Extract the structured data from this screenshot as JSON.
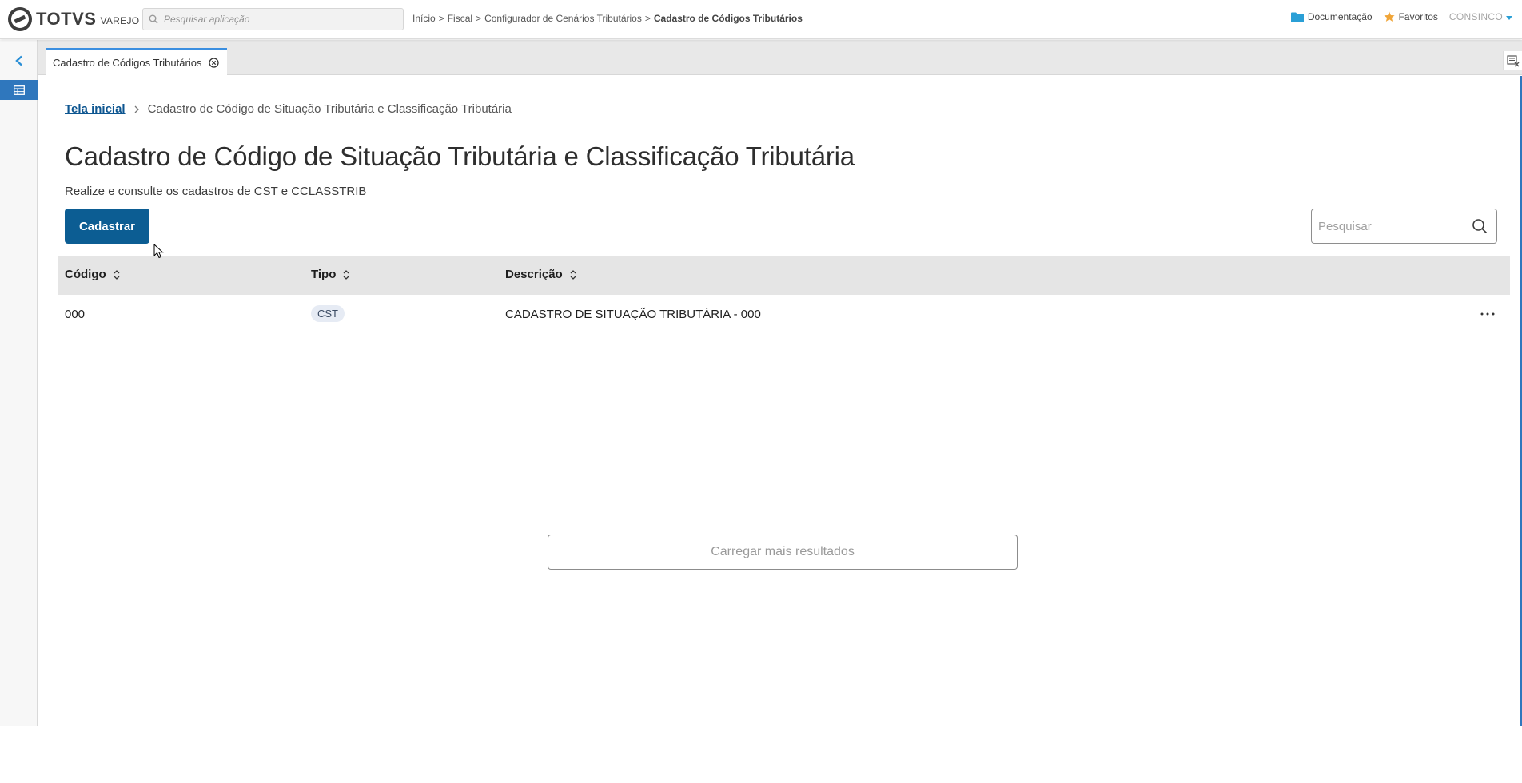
{
  "header": {
    "logo_text": "TOTVS",
    "logo_sub": "VAREJO",
    "app_search_placeholder": "Pesquisar aplicação",
    "breadcrumb": [
      "Início",
      "Fiscal",
      "Configurador de Cenários Tributários",
      "Cadastro de Códigos Tributários"
    ],
    "separator": ">",
    "docs_label": "Documentação",
    "favorites_label": "Favoritos",
    "user_label": "CONSINCO",
    "accent_color": "#2a9fd6",
    "star_color": "#f0a538"
  },
  "left_rail": {
    "toggle_icon": "chevron-left-icon",
    "active_item_icon": "table-icon",
    "active_color": "#2f77bd"
  },
  "tabs": [
    {
      "label": "Cadastro de Códigos Tributários",
      "close_icon": "close-circle-icon"
    }
  ],
  "tab_tool_icon": "clear-cache-icon",
  "page": {
    "breadcrumb_home": "Tela inicial",
    "breadcrumb_current": "Cadastro de Código de Situação Tributária e Classificação Tributária",
    "title": "Cadastro de Código de Situação Tributária e Classificação Tributária",
    "subtitle": "Realize e consulte os cadastros de CST e CCLASSTRIB",
    "primary_button": "Cadastrar",
    "primary_color": "#0c5d93",
    "search_placeholder": "Pesquisar"
  },
  "table": {
    "columns": [
      "Código",
      "Tipo",
      "Descrição"
    ],
    "rows": [
      {
        "codigo": "000",
        "tipo": "CST",
        "descricao": "CADASTRO DE SITUAÇÃO TRIBUTÁRIA - 000"
      }
    ],
    "load_more_label": "Carregar mais resultados"
  }
}
